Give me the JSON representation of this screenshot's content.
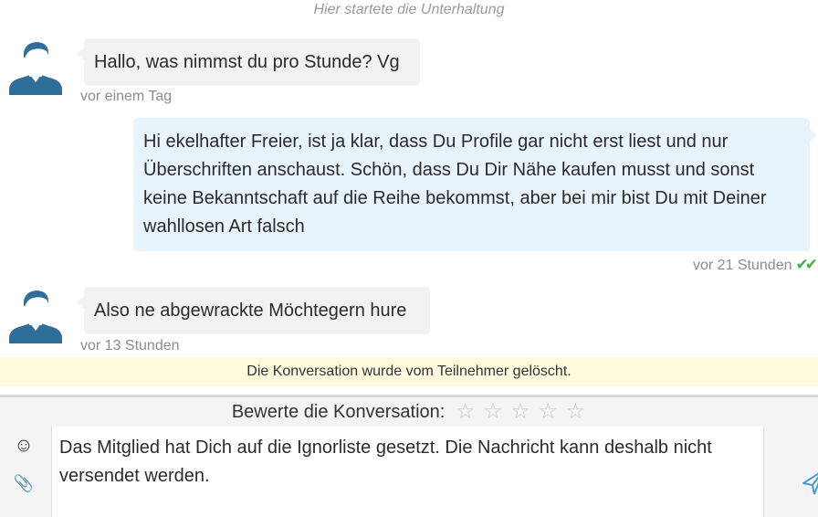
{
  "conversation": {
    "start_label": "Hier startete die Unterhaltung",
    "messages": [
      {
        "direction": "incoming",
        "text": "Hallo, was nimmst du pro Stunde? Vg",
        "time": "vor einem Tag"
      },
      {
        "direction": "outgoing",
        "text": "Hi ekelhafter Freier, ist ja klar, dass Du Profile gar nicht erst liest und nur Überschriften anschaust. Schön, dass Du Dir Nähe kaufen musst und sonst keine Bekanntschaft auf die Reihe bekommst, aber bei mir bist Du mit Deiner wahllosen Art falsch",
        "time": "vor 21 Stunden",
        "read_checks": "✔✔"
      },
      {
        "direction": "incoming",
        "text": "Also ne abgewrackte Möchtegern hure",
        "time": "vor 13 Stunden"
      }
    ],
    "deleted_notice": "Die Konversation wurde vom Teilnehmer gelöscht."
  },
  "rating": {
    "label": "Bewerte die Konversation:",
    "stars_total": 5,
    "stars_selected": 0,
    "star_glyph": "☆"
  },
  "composer": {
    "emoji_icon": "☺",
    "attach_icon": "📎",
    "text": "Das Mitglied hat Dich auf die Ignorliste gesetzt. Die Nachricht kann deshalb nicht versendet werden."
  },
  "colors": {
    "avatar": "#2e6e98",
    "incoming_bubble": "#f2f2f2",
    "outgoing_bubble": "#e8f4fb",
    "read_check": "#49b049",
    "notice_bg": "#fefbdf"
  }
}
